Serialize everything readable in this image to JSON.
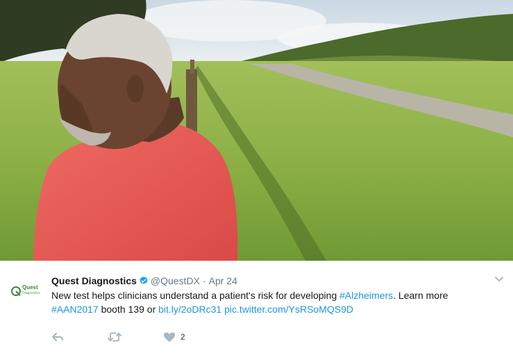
{
  "photo": {
    "alt_subject": "man-in-field",
    "sky_color": "#dbe6ee",
    "grass_color": "#8fb24a",
    "shirt_color": "#e95a55"
  },
  "tweet": {
    "author": {
      "name": "Quest Diagnostics",
      "handle": "@QuestDX",
      "verified": true,
      "avatar_logo_text": "Quest",
      "avatar_logo_sub": "Diagnostics"
    },
    "separator": "·",
    "date": "Apr 24",
    "text": {
      "part1": "New test helps clinicians understand a patient's risk for developing ",
      "hashtag1": "#Alzheimers",
      "part2": ". Learn more ",
      "hashtag2": "#AAN2017",
      "part3": " booth 139 or ",
      "link": "bit.ly/2oDRc31",
      "part4": " ",
      "pic_link": "pic.twitter.com/YsRSoMQS9D"
    },
    "actions": {
      "reply_icon": "reply-icon",
      "retweet_icon": "retweet-icon",
      "like_icon": "heart-icon",
      "like_count": "2"
    },
    "link_color": "#1b95e0",
    "meta_color": "#657786",
    "verified_color": "#1da1f2"
  }
}
